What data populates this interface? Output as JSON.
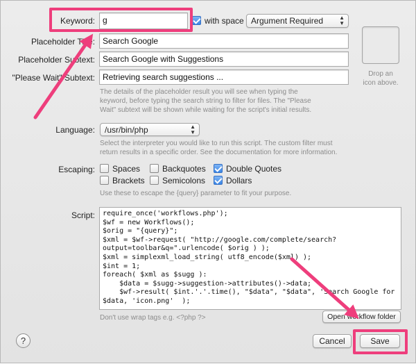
{
  "keyword": {
    "label": "Keyword:",
    "value": "g",
    "with_space_label": "with space",
    "with_space_checked": true,
    "argument_option": "Argument Required"
  },
  "placeholder_title": {
    "label": "Placeholder Title:",
    "value": "Search Google"
  },
  "placeholder_subtext": {
    "label": "Placeholder Subtext:",
    "value": "Search Google with Suggestions"
  },
  "please_wait_subtext": {
    "label": "\"Please Wait\" Subtext:",
    "value": "Retrieving search suggestions ..."
  },
  "placeholder_help": [
    "The details of the placeholder result you will see when typing the",
    "keyword, before typing the search string to filter for files. The \"Please",
    "Wait\" subtext will be shown while waiting for the script's initial results."
  ],
  "icon_drop": {
    "line1": "Drop an",
    "line2": "icon above."
  },
  "language": {
    "label": "Language:",
    "value": "/usr/bin/php",
    "help": [
      "Select the interpreter you would like to run this script. The custom filter must",
      "return results in a specific order. See the documentation for more information."
    ]
  },
  "escaping": {
    "label": "Escaping:",
    "options": [
      {
        "label": "Spaces",
        "checked": false
      },
      {
        "label": "Backquotes",
        "checked": false
      },
      {
        "label": "Double Quotes",
        "checked": true
      },
      {
        "label": "Brackets",
        "checked": false
      },
      {
        "label": "Semicolons",
        "checked": false
      },
      {
        "label": "Dollars",
        "checked": true
      }
    ],
    "help": "Use these to escape the {query} parameter to fit your purpose."
  },
  "script": {
    "label": "Script:",
    "lines": [
      "require_once('workflows.php');",
      "$wf = new Workflows();",
      "",
      "$orig = \"{query}\";",
      "$xml = $wf->request( \"http://google.com/complete/search?",
      "output=toolbar&q=\".urlencode( $orig ) );",
      "$xml = simplexml_load_string( utf8_encode($xml) );",
      "$int = 1;",
      "",
      "foreach( $xml as $sugg ):",
      "    $data = $sugg->suggestion->attributes()->data;",
      "    $wf->result( $int.'.'.time(), \"$data\", \"$data\", 'Search Google for '.",
      "$data, 'icon.png'  );"
    ],
    "help": "Don't use wrap tags e.g. <?php ?>",
    "open_folder_label": "Open workflow folder"
  },
  "buttons": {
    "help": "?",
    "cancel": "Cancel",
    "save": "Save"
  },
  "colors": {
    "highlight": "#ee3e7c",
    "checkbox_on": "#3a86e6",
    "help_text": "#8c8c8c"
  }
}
